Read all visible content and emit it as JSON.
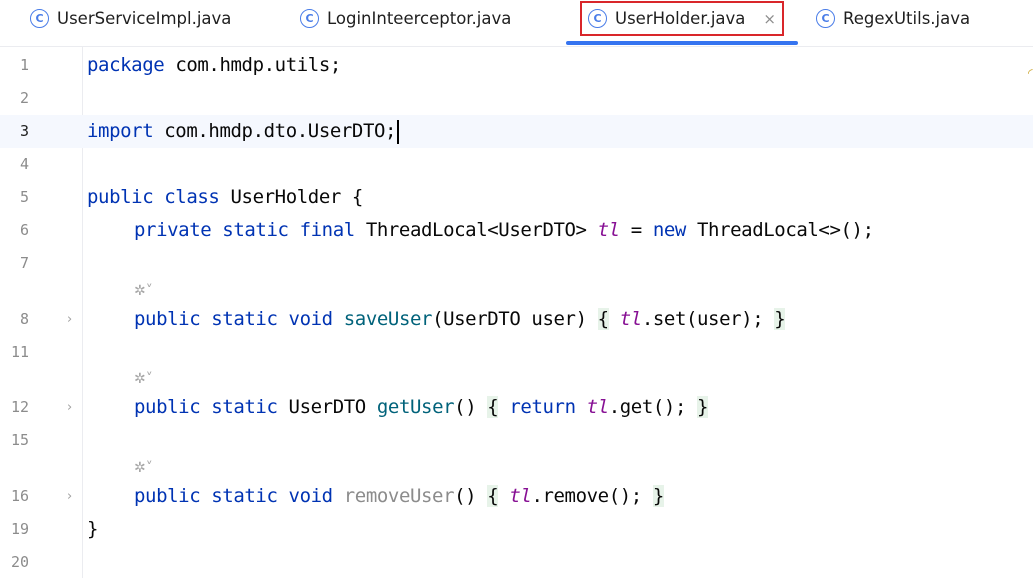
{
  "tabs": [
    {
      "label": "UserServiceImpl.java",
      "icon": "class-icon",
      "active": false
    },
    {
      "label": "LoginInteerceptor.java",
      "icon": "class-icon",
      "active": false
    },
    {
      "label": "UserHolder.java",
      "icon": "class-icon",
      "active": true
    },
    {
      "label": "RegexUtils.java",
      "icon": "class-icon",
      "active": false
    }
  ],
  "tab_icon_glyph": "C",
  "close_glyph": "×",
  "fold_glyph": "›",
  "ai_hint_glyph": "✲˅",
  "lines": {
    "l1": {
      "no": "1",
      "kw": "package",
      "rest": " com.hmdp.utils;"
    },
    "l2": {
      "no": "2"
    },
    "l3": {
      "no": "3",
      "kw": "import",
      "rest": " com.hmdp.dto.UserDTO;"
    },
    "l4": {
      "no": "4"
    },
    "l5": {
      "no": "5",
      "kw": "public class",
      "rest": " UserHolder {"
    },
    "l6": {
      "no": "6",
      "kw": "private static final",
      "type": " ThreadLocal<UserDTO> ",
      "field": "tl",
      "eq": " = ",
      "kw2": "new",
      "rest": " ThreadLocal<>();"
    },
    "l7": {
      "no": "7"
    },
    "l8": {
      "no": "8",
      "kw": "public static void",
      "fn": "saveUser",
      "params": "(UserDTO user)",
      "ob": "{",
      "field": "tl",
      "body": ".set(user); ",
      "cb": "}"
    },
    "l11": {
      "no": "11"
    },
    "l12": {
      "no": "12",
      "kw": "public static",
      "type": " UserDTO ",
      "fn": "getUser",
      "params": "()",
      "ob": "{",
      "kw2": "return",
      "field": "tl",
      "body": ".get(); ",
      "cb": "}"
    },
    "l15": {
      "no": "15"
    },
    "l16": {
      "no": "16",
      "kw": "public static void",
      "fn": "removeUser",
      "params": "()",
      "ob": "{",
      "field": "tl",
      "body": ".remove(); ",
      "cb": "}"
    },
    "l19": {
      "no": "19",
      "rest": "}"
    },
    "l20": {
      "no": "20"
    }
  },
  "colors": {
    "keyword": "#0033b3",
    "method": "#00627a",
    "field": "#871094",
    "fold_bg": "#e7f3e9",
    "active_tab_outline": "#d9262a",
    "tab_underline": "#3574f0"
  }
}
